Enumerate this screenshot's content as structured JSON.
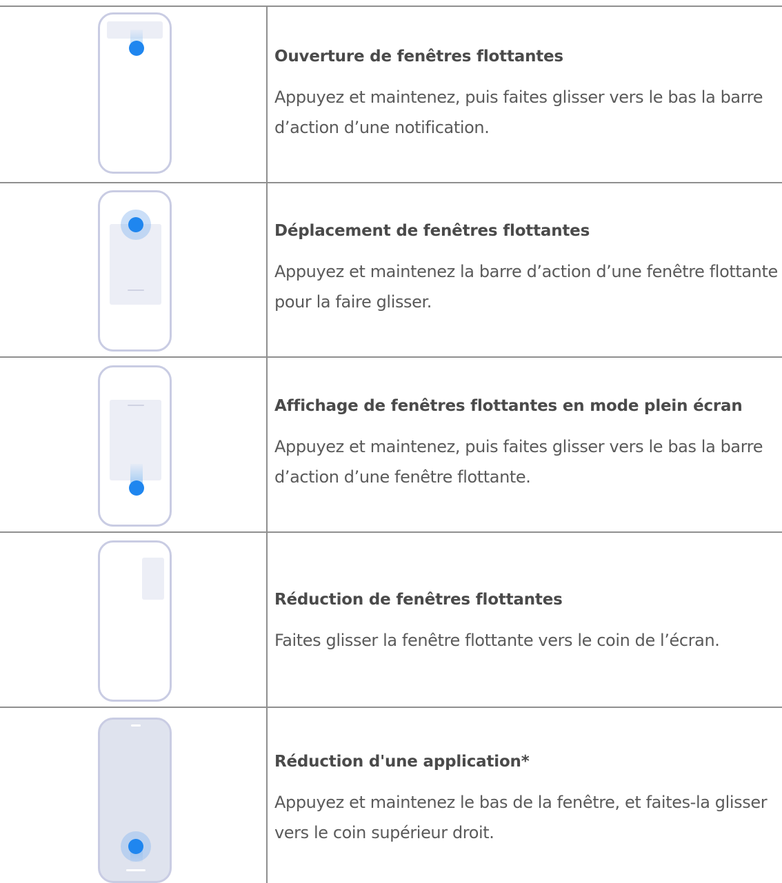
{
  "rows": [
    {
      "title": "Ouverture de fenêtres flottantes",
      "desc": "Appuyez et maintenez, puis faites glisser vers le bas la barre d’action d’une notification."
    },
    {
      "title": "Déplacement de fenêtres flottantes",
      "desc": "Appuyez et maintenez la barre d’action d’une fenêtre flottante pour la faire glisser."
    },
    {
      "title": "Affichage de fenêtres flottantes en mode plein écran",
      "desc": "Appuyez et maintenez, puis faites glisser vers le bas la barre d’action d’une fenêtre flottante."
    },
    {
      "title": "Réduction de fenêtres flottantes",
      "desc": "Faites glisser la fenêtre flottante vers le coin de l’écran."
    },
    {
      "title": "Réduction d'une application*",
      "desc": "Appuyez et maintenez le bas de la fenêtre, et faites-la glisser vers le coin supérieur droit."
    }
  ],
  "colors": {
    "rule": "#8f8f8f",
    "phone_border": "#c9cce3",
    "touch_dot": "#1f86ef",
    "title_text": "#4a4a4a",
    "body_text": "#5a5a5a"
  }
}
